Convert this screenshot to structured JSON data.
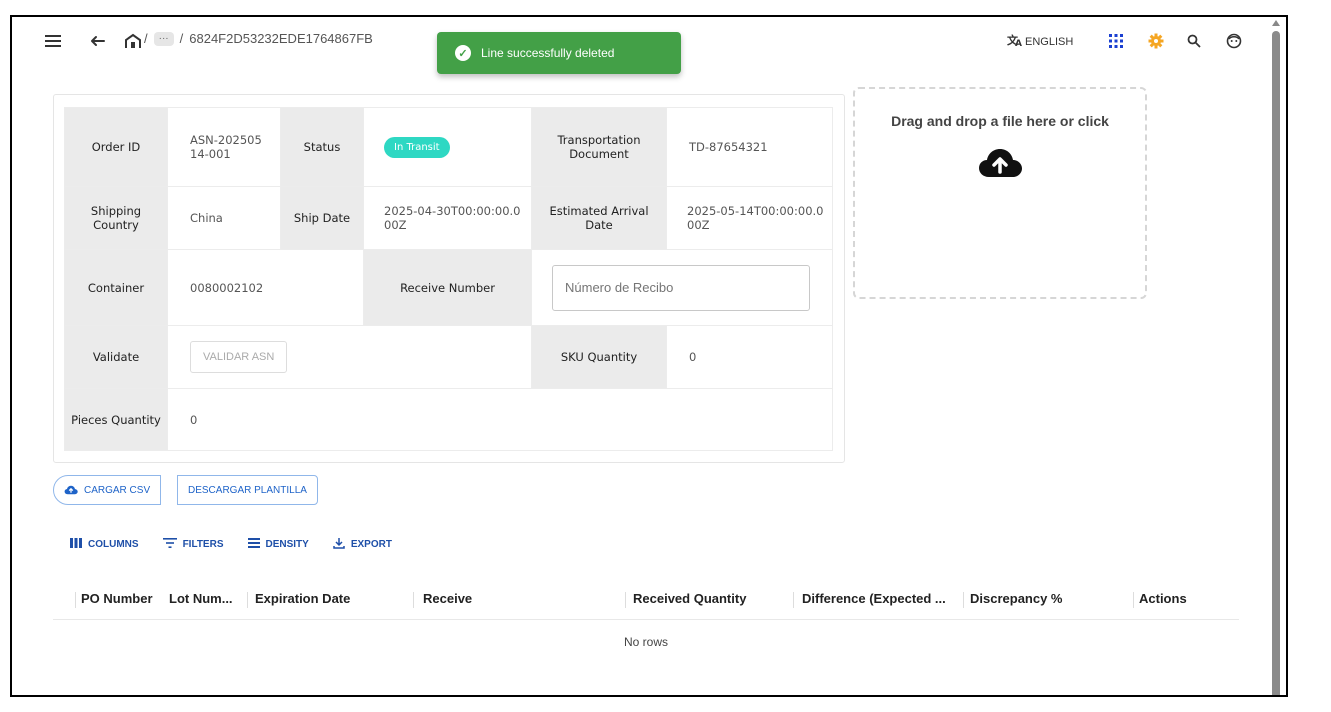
{
  "breadcrumb": {
    "sep1": "/",
    "ellipsis": "···",
    "sep2": "/",
    "id": "6824F2D53232EDE1764867FB"
  },
  "toast": {
    "message": "Line successfully deleted"
  },
  "language": {
    "label": "ENGLISH"
  },
  "icons": {
    "menu": "menu-icon",
    "back": "back-arrow-icon",
    "home": "home-icon",
    "translate": "translate-icon",
    "apps": "apps-grid-icon",
    "settings": "gear-icon",
    "search": "search-icon",
    "account": "account-icon",
    "upload": "cloud-upload-icon"
  },
  "colors": {
    "toast": "#43a047",
    "status_badge": "#2ed8c3",
    "accent": "#1e63c8",
    "settings_icon": "#f5a623",
    "apps_icon": "#1a3fd1"
  },
  "info": {
    "order_id_label": "Order ID",
    "order_id_value": "ASN-20250514-001",
    "status_label": "Status",
    "status_value": "In Transit",
    "transport_label": "Transportation Document",
    "transport_value": "TD-87654321",
    "shipping_country_label": "Shipping Country",
    "shipping_country_value": "China",
    "ship_date_label": "Ship Date",
    "ship_date_value": "2025-04-30T00:00:00.000Z",
    "eta_label": "Estimated Arrival Date",
    "eta_value": "2025-05-14T00:00:00.000Z",
    "container_label": "Container",
    "container_value": "0080002102",
    "receive_number_label": "Receive Number",
    "receive_number_placeholder": "Número de Recibo",
    "validate_label": "Validate",
    "validate_button": "VALIDAR ASN",
    "sku_qty_label": "SKU Quantity",
    "sku_qty_value": "0",
    "pieces_qty_label": "Pieces Quantity",
    "pieces_qty_value": "0"
  },
  "dropzone": {
    "text": "Drag and drop a file here or click"
  },
  "csv": {
    "upload_label": "CARGAR CSV",
    "template_label": "DESCARGAR PLANTILLA"
  },
  "toolbar": {
    "columns": "COLUMNS",
    "filters": "FILTERS",
    "density": "DENSITY",
    "export": "EXPORT"
  },
  "grid": {
    "columns": [
      "PO Number",
      "Lot Num...",
      "Expiration Date",
      "Receive",
      "Received Quantity",
      "Difference (Expected ...",
      "Discrepancy %",
      "Actions"
    ],
    "empty": "No rows"
  }
}
